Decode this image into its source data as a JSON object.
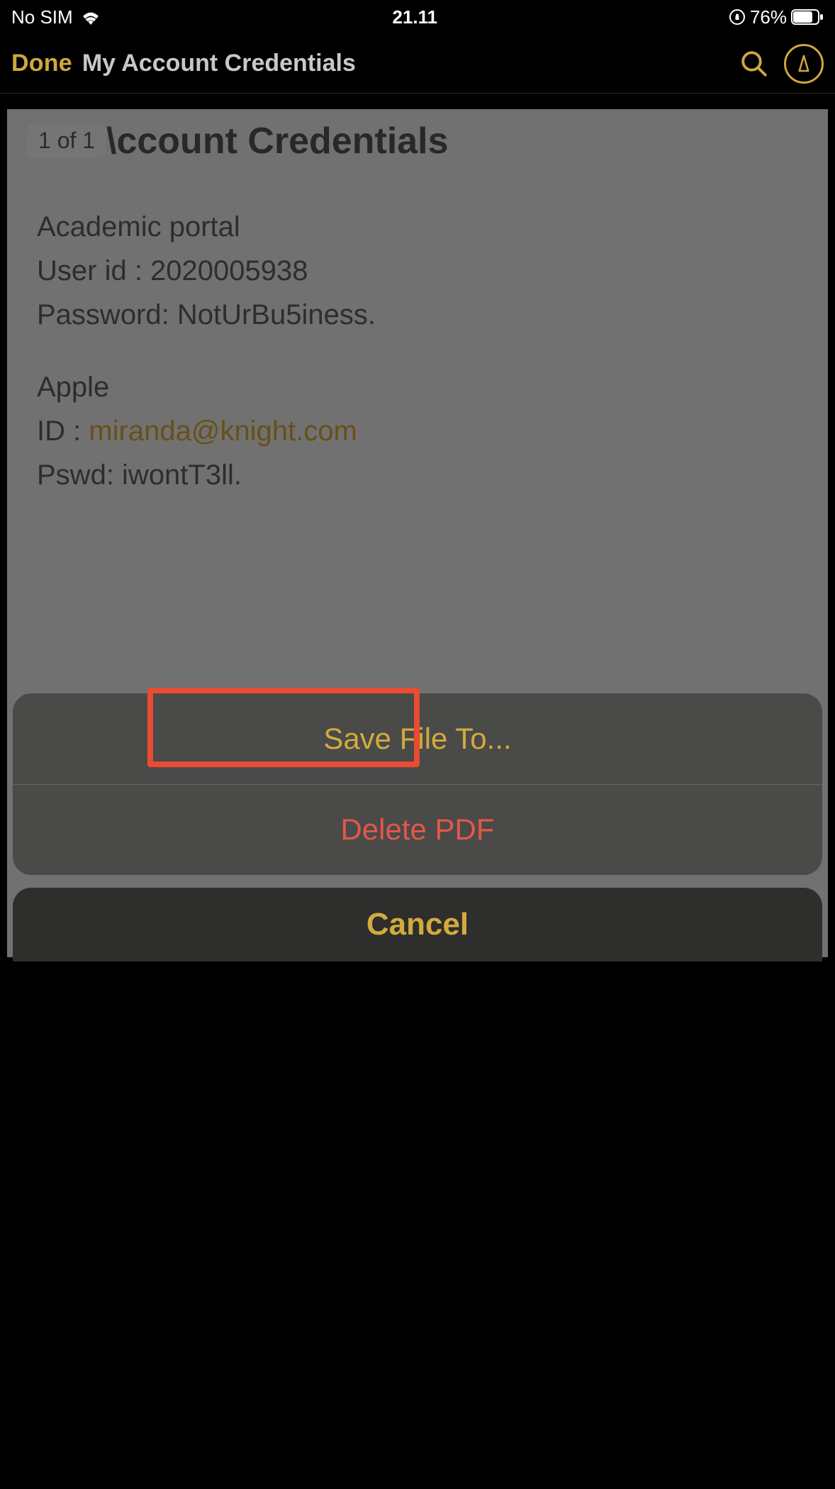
{
  "status": {
    "carrier": "No SIM",
    "time": "21.11",
    "battery_percent": "76%"
  },
  "nav": {
    "done_label": "Done",
    "title": "My Account Credentials"
  },
  "document": {
    "page_counter": "1 of 1",
    "title_visible": "\\ccount Credentials",
    "lines": [
      "Academic portal",
      "User id : 2020005938",
      "Password: NotUrBu5iness."
    ],
    "section2_heading": "Apple",
    "section2_id_label": "ID : ",
    "section2_id_value": "miranda@knight.com",
    "section2_pswd": "Pswd: iwontT3ll."
  },
  "sheet": {
    "save_label": "Save File To...",
    "delete_label": "Delete PDF",
    "cancel_label": "Cancel"
  }
}
